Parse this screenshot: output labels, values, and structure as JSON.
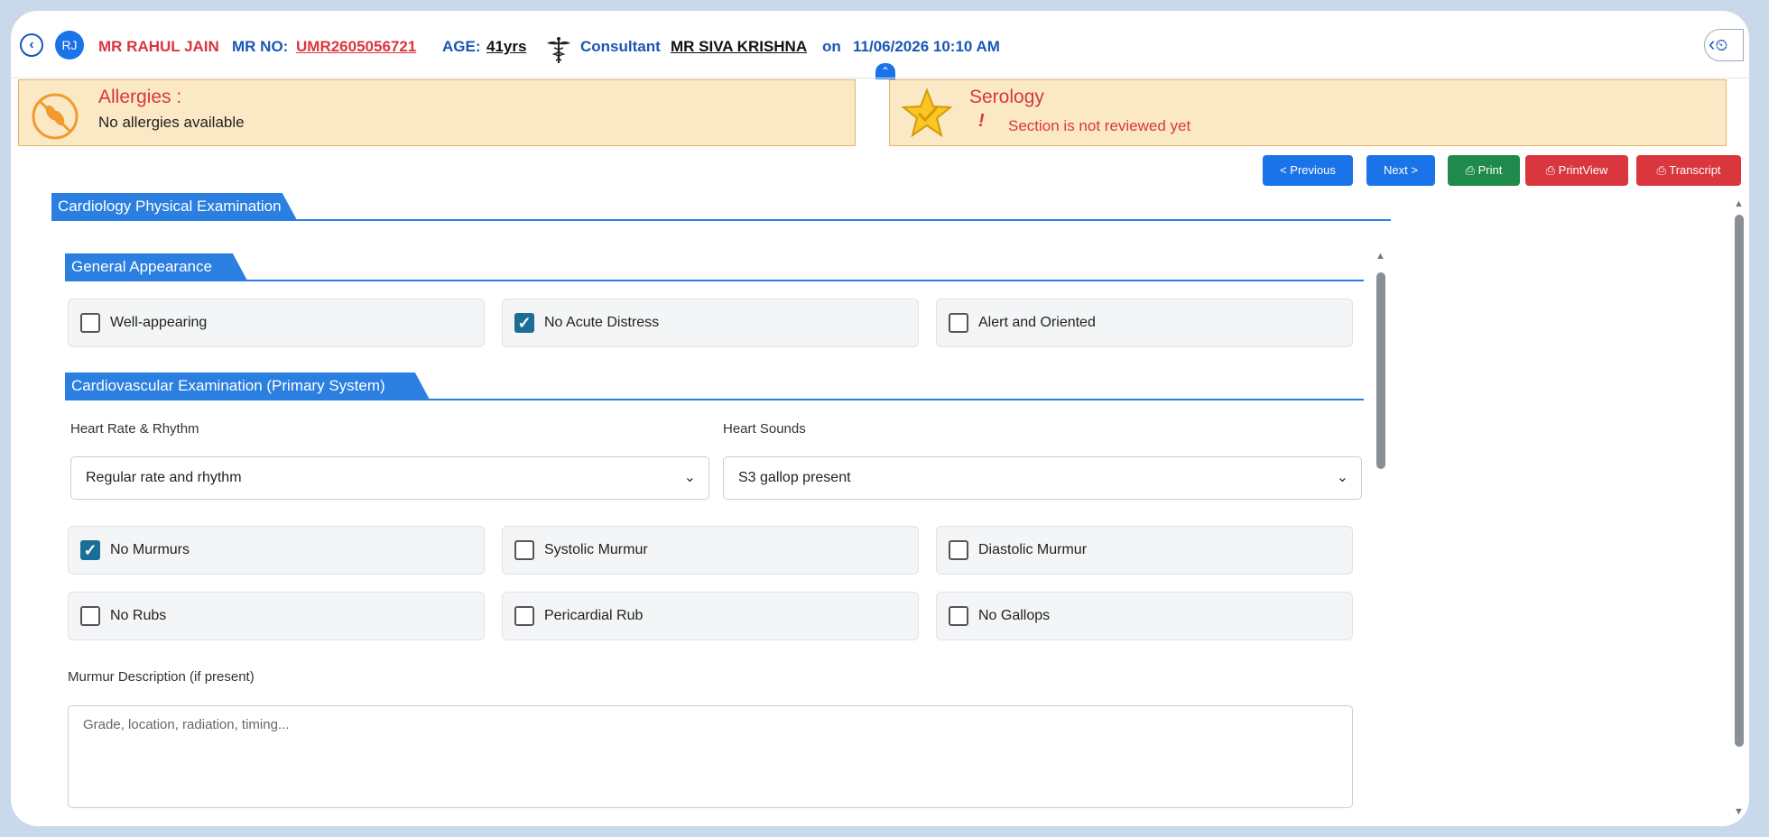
{
  "header": {
    "avatar_initials": "RJ",
    "patient_name": "MR RAHUL JAIN",
    "mr_no_label": "MR NO:",
    "mr_no": "UMR2605056721",
    "age_label": "AGE:",
    "age": "41yrs",
    "consultant_label": "Consultant",
    "consultant_name": "MR SIVA KRISHNA",
    "on_label": "on",
    "datetime": "11/06/2026 10:10 AM"
  },
  "allergies": {
    "title": "Allergies :",
    "text": "No allergies available"
  },
  "serology": {
    "title": "Serology",
    "warning_mark": "!",
    "text": "Section is not reviewed yet"
  },
  "toolbar": {
    "previous": "< Previous",
    "next": "Next >",
    "print": "Print",
    "printview": "PrintView",
    "transcript": "Transcript"
  },
  "section_title": "Cardiology Physical Examination",
  "general": {
    "title": "General Appearance",
    "items": [
      {
        "label": "Well-appearing",
        "checked": false
      },
      {
        "label": "No Acute Distress",
        "checked": true
      },
      {
        "label": "Alert and Oriented",
        "checked": false
      }
    ]
  },
  "cardio": {
    "title": "Cardiovascular Examination (Primary System)",
    "heart_rate_label": "Heart Rate & Rhythm",
    "heart_rate_value": "Regular rate and rhythm",
    "heart_sounds_label": "Heart Sounds",
    "heart_sounds_value": "S3 gallop present",
    "row1": [
      {
        "label": "No Murmurs",
        "checked": true
      },
      {
        "label": "Systolic Murmur",
        "checked": false
      },
      {
        "label": "Diastolic Murmur",
        "checked": false
      }
    ],
    "row2": [
      {
        "label": "No Rubs",
        "checked": false
      },
      {
        "label": "Pericardial Rub",
        "checked": false
      },
      {
        "label": "No Gallops",
        "checked": false
      }
    ],
    "murmur_desc_label": "Murmur Description (if present)",
    "murmur_desc_placeholder": "Grade, location, radiation, timing..."
  },
  "colors": {
    "primary": "#2b7fe0",
    "danger": "#d9363e",
    "success": "#1f8a4c",
    "alert_bg": "#fbe9c6"
  }
}
